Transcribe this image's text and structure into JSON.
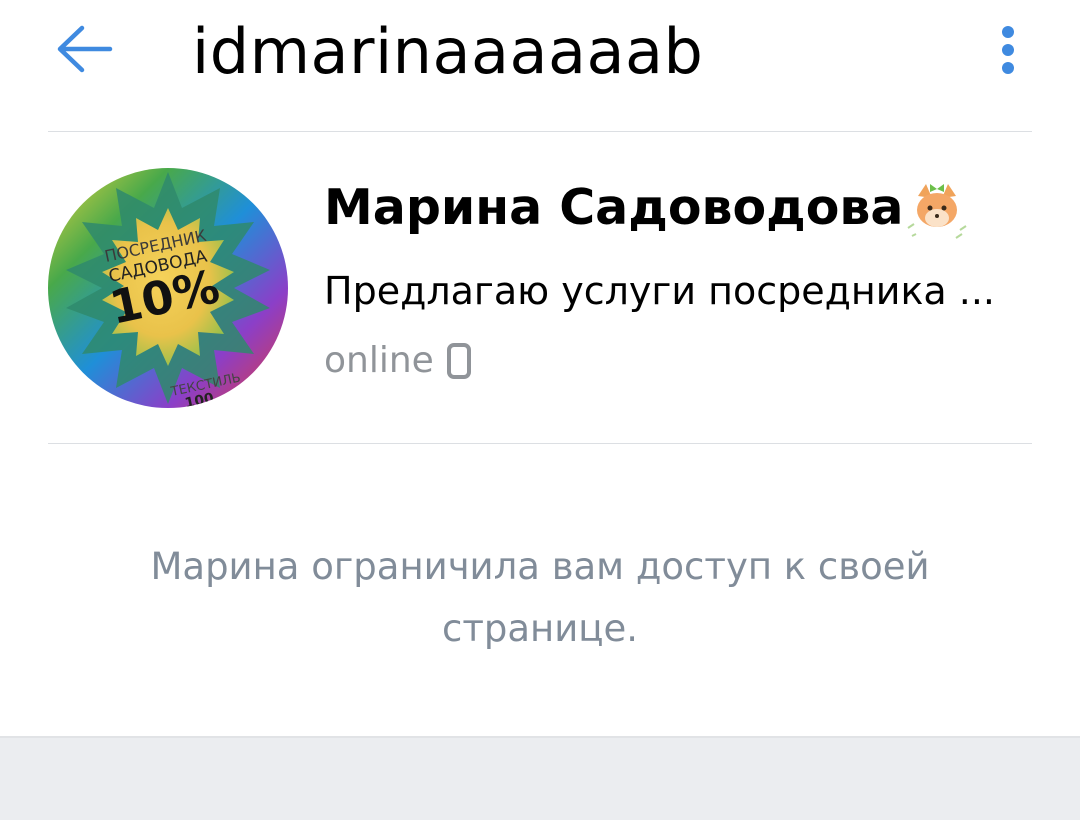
{
  "header": {
    "title": "idmarinaaaaaab",
    "back_icon": "arrow-left-icon",
    "more_icon": "more-vertical-icon",
    "accent_color": "#3f8ae0"
  },
  "profile": {
    "avatar": {
      "line1": "ПОСРЕДНИК",
      "line2": "САДОВОДА",
      "big": "10%",
      "bottom": "ТЕКСТИЛЬ",
      "bottom2": "100"
    },
    "name": "Марина Садоводова",
    "name_emoji": "fox-face-icon",
    "status": "Предлагаю услуги посредника ...",
    "online": "online",
    "online_device_icon": "mobile-phone-icon"
  },
  "restricted_message": "Марина ограничила вам доступ к своей странице.",
  "colors": {
    "secondary_text": "#818c99",
    "online_text": "#909499",
    "divider": "#dcdfe3",
    "footer_bg": "#ebedf0"
  }
}
